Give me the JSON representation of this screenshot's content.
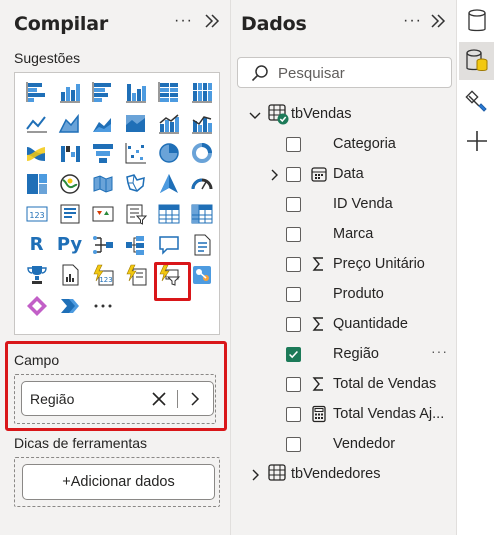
{
  "build_pane": {
    "title": "Compilar",
    "suggestions_label": "Sugestões",
    "visuals": [
      "stacked-bar-chart-icon",
      "stacked-column-chart-icon",
      "clustered-bar-chart-icon",
      "clustered-column-chart-icon",
      "100-stacked-bar-chart-icon",
      "100-stacked-column-chart-icon",
      "line-chart-icon",
      "area-chart-icon",
      "stacked-area-chart-icon",
      "100-stacked-area-chart-icon",
      "line-and-stacked-column-chart-icon",
      "line-and-clustered-column-chart-icon",
      "ribbon-chart-icon",
      "waterfall-chart-icon",
      "funnel-chart-icon",
      "scatter-chart-icon",
      "pie-chart-icon",
      "donut-chart-icon",
      "treemap-icon",
      "map-icon",
      "filled-map-icon",
      "shape-map-icon",
      "azure-map-icon",
      "gauge-icon",
      "card-icon",
      "multi-row-card-icon",
      "kpi-icon",
      "slicer-icon",
      "table-icon",
      "matrix-icon",
      "r-script-visual-icon",
      "python-visual-icon",
      "key-influencers-icon",
      "decomposition-tree-icon",
      "qa-icon",
      "smart-narrative-icon",
      "trophy-icon",
      "paginated-report-icon",
      "power-apps-icon",
      "power-automate-icon",
      "power-automate-filter-icon",
      "arcgis-map-icon",
      "power-apps-diamond-icon",
      "chevron-visual-icon",
      "more-visuals-icon"
    ],
    "selected_visual_index": 40,
    "field_section_label": "Campo",
    "field_value": "Região",
    "tooltips_label": "Dicas de ferramentas",
    "add_data_label": "+Adicionar dados"
  },
  "data_pane": {
    "title": "Dados",
    "search_placeholder": "Pesquisar",
    "tables": [
      {
        "name": "tbVendas",
        "expanded": true,
        "fields": [
          {
            "name": "Categoria",
            "icon": "",
            "checked": false,
            "expandable": false
          },
          {
            "name": "Data",
            "icon": "calendar-icon",
            "checked": false,
            "expandable": true
          },
          {
            "name": "ID Venda",
            "icon": "",
            "checked": false,
            "expandable": false
          },
          {
            "name": "Marca",
            "icon": "",
            "checked": false,
            "expandable": false
          },
          {
            "name": "Preço Unitário",
            "icon": "sigma-icon",
            "checked": false,
            "expandable": false
          },
          {
            "name": "Produto",
            "icon": "",
            "checked": false,
            "expandable": false
          },
          {
            "name": "Quantidade",
            "icon": "sigma-icon",
            "checked": false,
            "expandable": false
          },
          {
            "name": "Região",
            "icon": "",
            "checked": true,
            "expandable": false
          },
          {
            "name": "Total de Vendas",
            "icon": "sigma-icon",
            "checked": false,
            "expandable": false
          },
          {
            "name": "Total Vendas Aj...",
            "icon": "calculator-icon",
            "checked": false,
            "expandable": false
          },
          {
            "name": "Vendedor",
            "icon": "",
            "checked": false,
            "expandable": false
          }
        ]
      },
      {
        "name": "tbVendedores",
        "expanded": false,
        "fields": []
      }
    ],
    "more_glyph": "···"
  },
  "pane_more_glyph": "···",
  "colors": {
    "accent_green": "#1c7a58",
    "selection_red": "#d91619",
    "visual_blue": "#1f6fb7",
    "visual_yellow": "#f2c811"
  }
}
